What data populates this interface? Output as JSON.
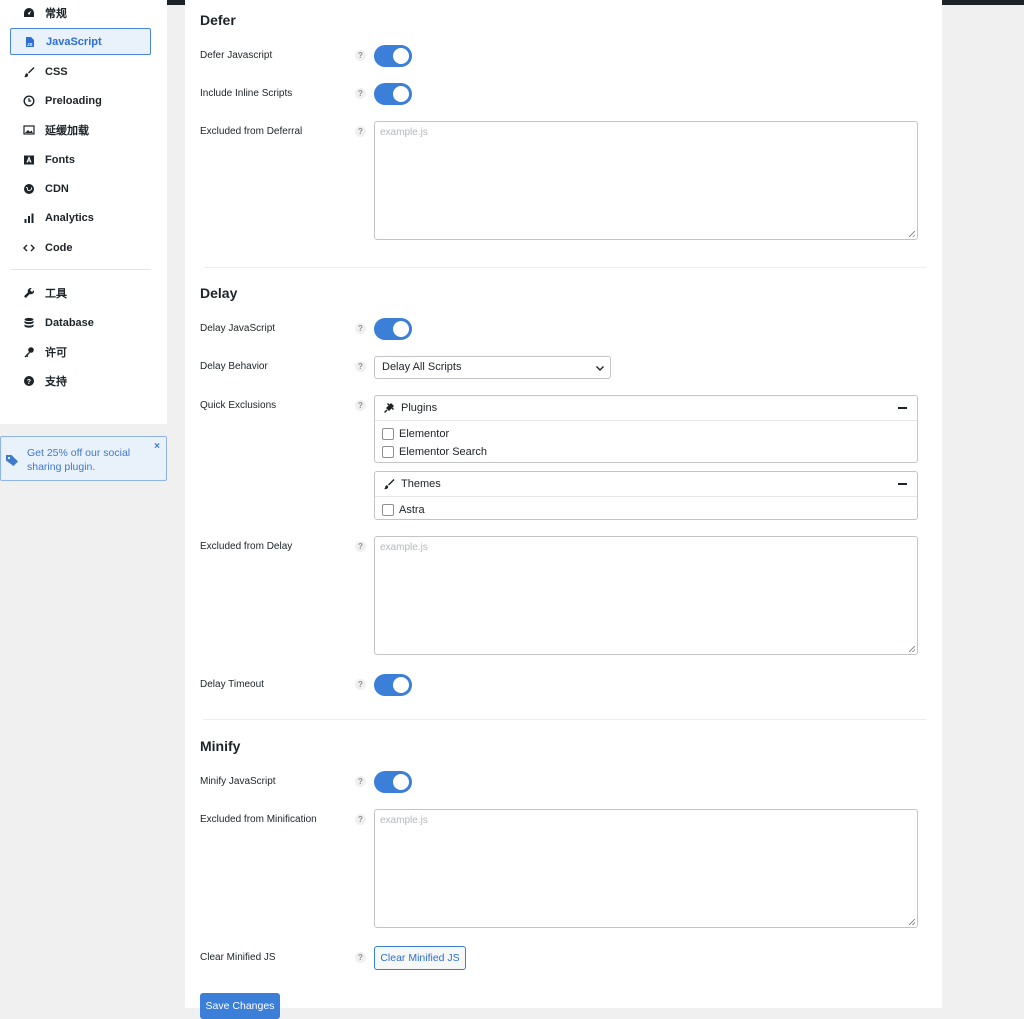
{
  "sidebar": {
    "items": [
      {
        "label": "常规",
        "icon": "dashboard-icon"
      },
      {
        "label": "JavaScript",
        "icon": "js-file-icon",
        "active": true
      },
      {
        "label": "CSS",
        "icon": "brush-icon"
      },
      {
        "label": "Preloading",
        "icon": "clock-icon"
      },
      {
        "label": "延缓加载",
        "icon": "image-icon"
      },
      {
        "label": "Fonts",
        "icon": "font-icon"
      },
      {
        "label": "CDN",
        "icon": "globe-icon"
      },
      {
        "label": "Analytics",
        "icon": "bar-chart-icon"
      },
      {
        "label": "Code",
        "icon": "code-icon"
      },
      {
        "label": "工具",
        "icon": "wrench-icon"
      },
      {
        "label": "Database",
        "icon": "database-icon"
      },
      {
        "label": "许可",
        "icon": "key-icon"
      },
      {
        "label": "支持",
        "icon": "question-circle-icon"
      }
    ],
    "promo": {
      "text": "Get 25% off our social sharing plugin.",
      "close": "×"
    }
  },
  "defer": {
    "title": "Defer",
    "defer_js_label": "Defer Javascript",
    "defer_js_on": true,
    "inline_label": "Include Inline Scripts",
    "inline_on": true,
    "excluded_label": "Excluded from Deferral",
    "excluded_placeholder": "example.js"
  },
  "delay": {
    "title": "Delay",
    "delay_js_label": "Delay JavaScript",
    "delay_js_on": true,
    "behavior_label": "Delay Behavior",
    "behavior_value": "Delay All Scripts",
    "quick_label": "Quick Exclusions",
    "plugins": {
      "title": "Plugins",
      "items": [
        "Elementor",
        "Elementor Search"
      ]
    },
    "themes": {
      "title": "Themes",
      "items": [
        "Astra"
      ]
    },
    "excluded_label": "Excluded from Delay",
    "excluded_placeholder": "example.js",
    "timeout_label": "Delay Timeout",
    "timeout_on": true
  },
  "minify": {
    "title": "Minify",
    "minify_js_label": "Minify JavaScript",
    "minify_js_on": true,
    "excluded_label": "Excluded from Minification",
    "excluded_placeholder": "example.js",
    "clear_label": "Clear Minified JS",
    "clear_button": "Clear Minified JS"
  },
  "help_glyph": "?",
  "save_button": "Save Changes",
  "colors": {
    "accent": "#3b7fd9",
    "active_bg": "#e9f1fb"
  }
}
